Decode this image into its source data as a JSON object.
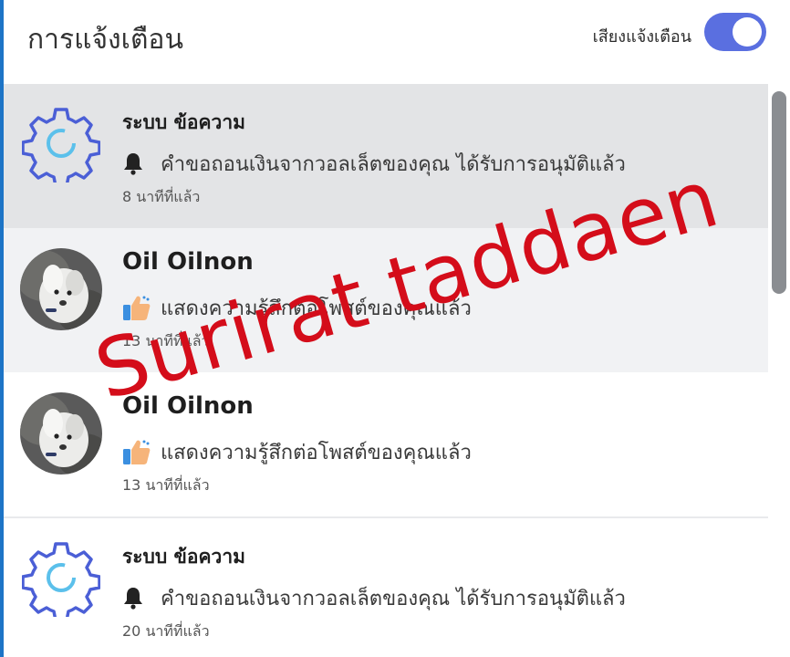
{
  "header": {
    "title": "การแจ้งเตือน",
    "sound_label": "เสียงแจ้งเตือน",
    "sound_enabled": true,
    "accent_color": "#5a6fe0"
  },
  "notifications": [
    {
      "type": "system",
      "icon": "gear-icon",
      "title": "ระบบ ข้อความ",
      "message_icon": "bell-icon",
      "message": "คำขอถอนเงินจากวอลเล็ตของคุณ ได้รับการอนุมัติแล้ว",
      "time": "8 นาทีที่แล้ว"
    },
    {
      "type": "user",
      "icon": "avatar",
      "title": "Oil Oilnon",
      "message_icon": "thumbs-up-icon",
      "message": "แสดงความรู้สึกต่อโพสต์ของคุณแล้ว",
      "time": "13 นาทีที่แล้ว"
    },
    {
      "type": "user",
      "icon": "avatar",
      "title": "Oil Oilnon",
      "message_icon": "thumbs-up-icon",
      "message": "แสดงความรู้สึกต่อโพสต์ของคุณแล้ว",
      "time": "13 นาทีที่แล้ว"
    },
    {
      "type": "system",
      "icon": "gear-icon",
      "title": "ระบบ ข้อความ",
      "message_icon": "bell-icon",
      "message": "คำขอถอนเงินจากวอลเล็ตของคุณ ได้รับการอนุมัติแล้ว",
      "time": "20 นาทีที่แล้ว"
    }
  ],
  "watermark": "Surirat taddaen"
}
